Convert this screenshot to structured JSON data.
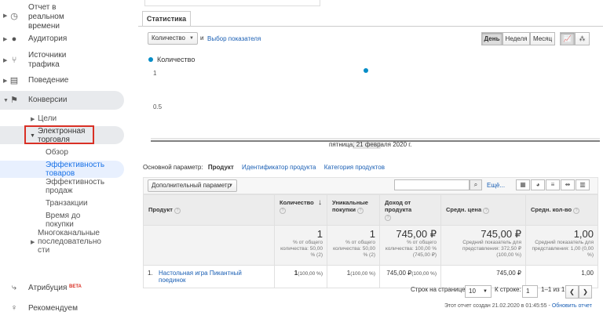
{
  "sidebar": {
    "items": [
      {
        "label": "Отчет в\nреальном\nвремени",
        "icon": "clock-icon"
      },
      {
        "label": "Аудитория",
        "icon": "person-icon"
      },
      {
        "label": "Источники\nтрафика",
        "icon": "acquisition-icon"
      },
      {
        "label": "Поведение",
        "icon": "behavior-icon"
      },
      {
        "label": "Конверсии",
        "icon": "flag-icon"
      }
    ],
    "sub": {
      "goals": "Цели",
      "ecommerce": "Электронная\nторговля",
      "overview": "Обзор",
      "product_perf": "Эффективность\nтоваров",
      "sales_perf": "Эффективность\nпродаж",
      "transactions": "Транзакции",
      "time_to_purchase": "Время до\nпокупки",
      "multichannel": "Многоканальные\nпоследовательно\nсти"
    },
    "attribution": "Атрибуция",
    "beta": "BETA",
    "recommended": "Рекомендуем"
  },
  "tab": "Статистика",
  "controls": {
    "metric_select": "Количество",
    "and": "и",
    "choose_metric": "Выбор показателя",
    "day": "День",
    "week": "Неделя",
    "month": "Месяц"
  },
  "chart_data": {
    "type": "line",
    "series": [
      {
        "name": "Количество",
        "values": [
          1
        ]
      }
    ],
    "x": [
      "пятница, 21 февраля 2020 г."
    ],
    "yticks": [
      "1",
      "0.5"
    ],
    "ylim": [
      0,
      1
    ]
  },
  "dims": {
    "primary": "Основной параметр:",
    "product": "Продукт",
    "sku": "Идентификатор продукта",
    "category": "Категория продуктов"
  },
  "toolbar": {
    "secondary": "Дополнительный параметр",
    "more": "Ещё..."
  },
  "table": {
    "headers": [
      "Продукт",
      "Количество",
      "Уникальные покупки",
      "Доход от продукта",
      "Средн. цена",
      "Средн. кол-во"
    ],
    "totals": [
      {
        "big": "1",
        "small": "% от общего количества: 50,00 % (2)"
      },
      {
        "big": "1",
        "small": "% от общего количества: 50,00 % (2)"
      },
      {
        "big": "745,00 ₽",
        "small": "% от общего количества: 100,00 % (745,00 ₽)"
      },
      {
        "big": "745,00 ₽",
        "small": "Средний показатель для представления: 372,50 ₽ (100,00 %)"
      },
      {
        "big": "1,00",
        "small": "Средний показатель для представления: 1,00 (0,00 %)"
      }
    ],
    "rows": [
      {
        "idx": "1.",
        "product": "Настольная игра Пикантный поединок",
        "qty": "1",
        "qty_pct": "(100,00 %)",
        "uniq": "1",
        "uniq_pct": "(100,00 %)",
        "rev": "745,00 ₽",
        "rev_pct": "(100,00 %)",
        "price": "745,00 ₽",
        "avg_qty": "1,00"
      }
    ]
  },
  "pager": {
    "rows_label": "Строк на странице:",
    "rows_value": "10",
    "goto_label": "К строке:",
    "goto_value": "1",
    "range": "1–1 из 1"
  },
  "footer": {
    "created": "Этот отчет создан 21.02.2020 в 01:45:55 -",
    "refresh": "Обновить отчет"
  }
}
